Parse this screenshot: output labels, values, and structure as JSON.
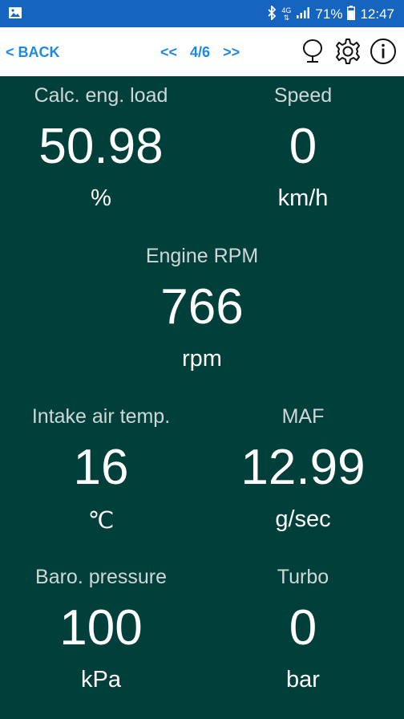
{
  "status_bar": {
    "gallery_icon": "image-icon",
    "bluetooth_icon": "bluetooth-icon",
    "network": "4G",
    "signal_icon": "signal-icon",
    "battery_percent": "71%",
    "battery_icon": "battery-icon",
    "time": "12:47"
  },
  "toolbar": {
    "back_label": "< BACK",
    "prev_label": "<<",
    "page_indicator": "4/6",
    "next_label": ">>",
    "icons": [
      "microphone-icon",
      "gear-icon",
      "info-icon"
    ]
  },
  "gauges": [
    {
      "label": "Calc. eng. load",
      "value": "50.98",
      "unit": "%"
    },
    {
      "label": "Speed",
      "value": "0",
      "unit": "km/h"
    },
    {
      "label": "Engine RPM",
      "value": "766",
      "unit": "rpm"
    },
    {
      "label": "Intake air temp.",
      "value": "16",
      "unit": "℃"
    },
    {
      "label": "MAF",
      "value": "12.99",
      "unit": "g/sec"
    },
    {
      "label": "Baro. pressure",
      "value": "100",
      "unit": "kPa"
    },
    {
      "label": "Turbo",
      "value": "0",
      "unit": "bar"
    }
  ],
  "colors": {
    "status_bar": "#1565C0",
    "toolbar_bg": "#FFFFFF",
    "accent": "#1E88E5",
    "background": "#003F3A"
  }
}
